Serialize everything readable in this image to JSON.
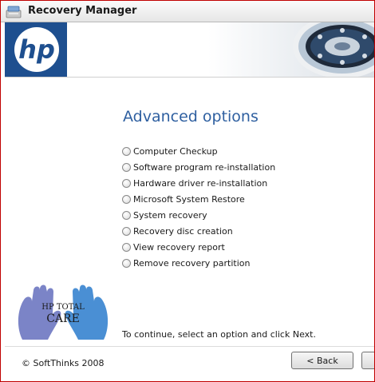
{
  "window": {
    "title": "Recovery Manager"
  },
  "banner": {
    "logo_text": "hp"
  },
  "main": {
    "heading": "Advanced options",
    "options": [
      {
        "label": "Computer Checkup",
        "selected": false
      },
      {
        "label": "Software program re-installation",
        "selected": false
      },
      {
        "label": "Hardware driver re-installation",
        "selected": false
      },
      {
        "label": "Microsoft System Restore",
        "selected": false
      },
      {
        "label": "System recovery",
        "selected": false
      },
      {
        "label": "Recovery disc creation",
        "selected": false
      },
      {
        "label": "View recovery report",
        "selected": false
      },
      {
        "label": "Remove recovery partition",
        "selected": false
      }
    ],
    "instruction": "To continue, select an option and click Next."
  },
  "care_logo": {
    "line1": "HP TOTAL",
    "line2": "CARE"
  },
  "footer": {
    "copyright": "© SoftThinks 2008",
    "back_label": "< Back",
    "next_label": ""
  },
  "colors": {
    "brand_blue": "#1e4f8f",
    "heading_blue": "#2e5fa0",
    "frame_red": "#c00000"
  }
}
